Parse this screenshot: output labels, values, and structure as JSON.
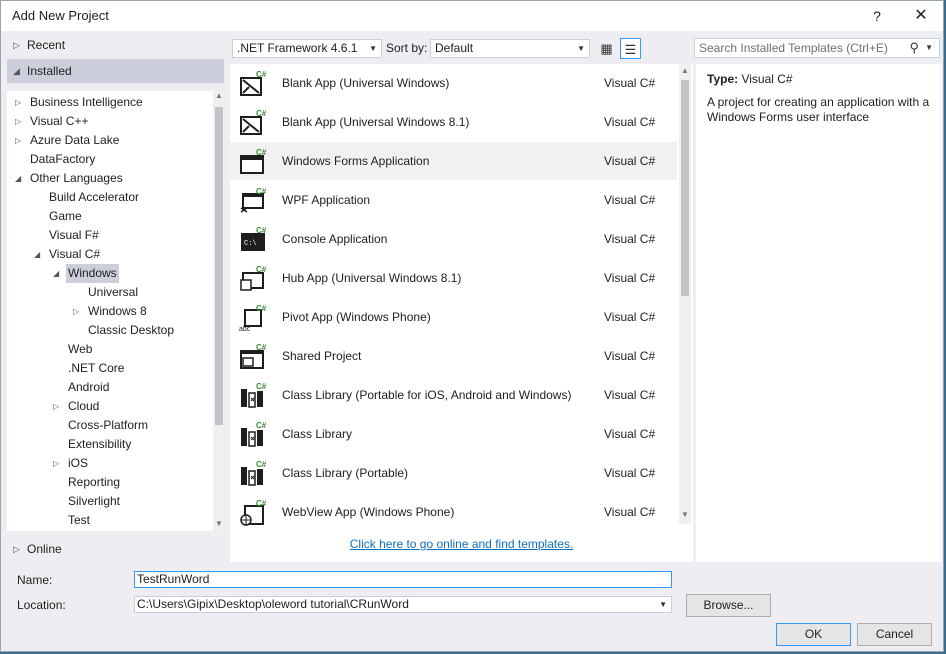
{
  "window": {
    "title": "Add New Project",
    "help_label": "?",
    "close_label": "✕"
  },
  "left": {
    "recent_label": "Recent",
    "installed_label": "Installed",
    "online_label": "Online",
    "tree": [
      {
        "label": "Business Intelligence",
        "level": 0,
        "expander": "collapsed"
      },
      {
        "label": "Visual C++",
        "level": 0,
        "expander": "collapsed"
      },
      {
        "label": "Azure Data Lake",
        "level": 0,
        "expander": "collapsed"
      },
      {
        "label": "DataFactory",
        "level": 0,
        "expander": "none"
      },
      {
        "label": "Other Languages",
        "level": 0,
        "expander": "expanded"
      },
      {
        "label": "Build Accelerator",
        "level": 1,
        "expander": "none"
      },
      {
        "label": "Game",
        "level": 1,
        "expander": "none"
      },
      {
        "label": "Visual F#",
        "level": 1,
        "expander": "none"
      },
      {
        "label": "Visual C#",
        "level": 1,
        "expander": "expanded"
      },
      {
        "label": "Windows",
        "level": 2,
        "expander": "expanded",
        "selected": true
      },
      {
        "label": "Universal",
        "level": 3,
        "expander": "none"
      },
      {
        "label": "Windows 8",
        "level": 3,
        "expander": "collapsed"
      },
      {
        "label": "Classic Desktop",
        "level": 3,
        "expander": "none"
      },
      {
        "label": "Web",
        "level": 2,
        "expander": "none"
      },
      {
        "label": ".NET Core",
        "level": 2,
        "expander": "none"
      },
      {
        "label": "Android",
        "level": 2,
        "expander": "none"
      },
      {
        "label": "Cloud",
        "level": 2,
        "expander": "collapsed"
      },
      {
        "label": "Cross-Platform",
        "level": 2,
        "expander": "none"
      },
      {
        "label": "Extensibility",
        "level": 2,
        "expander": "none"
      },
      {
        "label": "iOS",
        "level": 2,
        "expander": "collapsed"
      },
      {
        "label": "Reporting",
        "level": 2,
        "expander": "none"
      },
      {
        "label": "Silverlight",
        "level": 2,
        "expander": "none"
      },
      {
        "label": "Test",
        "level": 2,
        "expander": "none"
      }
    ]
  },
  "toolbar": {
    "framework_value": ".NET Framework 4.6.1",
    "sort_label": "Sort by:",
    "sort_value": "Default",
    "search_placeholder": "Search Installed Templates (Ctrl+E)"
  },
  "templates": [
    {
      "name": "Blank App (Universal Windows)",
      "lang": "Visual C#",
      "icon": "universal-app-icon"
    },
    {
      "name": "Blank App (Universal Windows 8.1)",
      "lang": "Visual C#",
      "icon": "universal-app-icon"
    },
    {
      "name": "Windows Forms Application",
      "lang": "Visual C#",
      "icon": "windows-forms-icon",
      "selected": true
    },
    {
      "name": "WPF Application",
      "lang": "Visual C#",
      "icon": "wpf-icon"
    },
    {
      "name": "Console Application",
      "lang": "Visual C#",
      "icon": "console-icon"
    },
    {
      "name": "Hub App (Universal Windows 8.1)",
      "lang": "Visual C#",
      "icon": "hub-app-icon"
    },
    {
      "name": "Pivot App (Windows Phone)",
      "lang": "Visual C#",
      "icon": "pivot-app-icon"
    },
    {
      "name": "Shared Project",
      "lang": "Visual C#",
      "icon": "shared-project-icon"
    },
    {
      "name": "Class Library (Portable for iOS, Android and Windows)",
      "lang": "Visual C#",
      "icon": "class-library-icon"
    },
    {
      "name": "Class Library",
      "lang": "Visual C#",
      "icon": "class-library-icon"
    },
    {
      "name": "Class Library (Portable)",
      "lang": "Visual C#",
      "icon": "class-library-icon"
    },
    {
      "name": "WebView App (Windows Phone)",
      "lang": "Visual C#",
      "icon": "webview-app-icon"
    }
  ],
  "online_link": "Click here to go online and find templates.",
  "info": {
    "type_label": "Type:",
    "type_value": "Visual C#",
    "description": "A project for creating an application with a Windows Forms user interface"
  },
  "form": {
    "name_label": "Name:",
    "name_value": "TestRunWord",
    "location_label": "Location:",
    "location_value": "C:\\Users\\Gipix\\Desktop\\oleword tutorial\\CRunWord",
    "browse_label": "Browse...",
    "ok_label": "OK",
    "cancel_label": "Cancel"
  },
  "colors": {
    "accent": "#3399ff",
    "selection": "#cccedb",
    "link": "#0e70c0",
    "csharp_badge": "#388a34"
  }
}
